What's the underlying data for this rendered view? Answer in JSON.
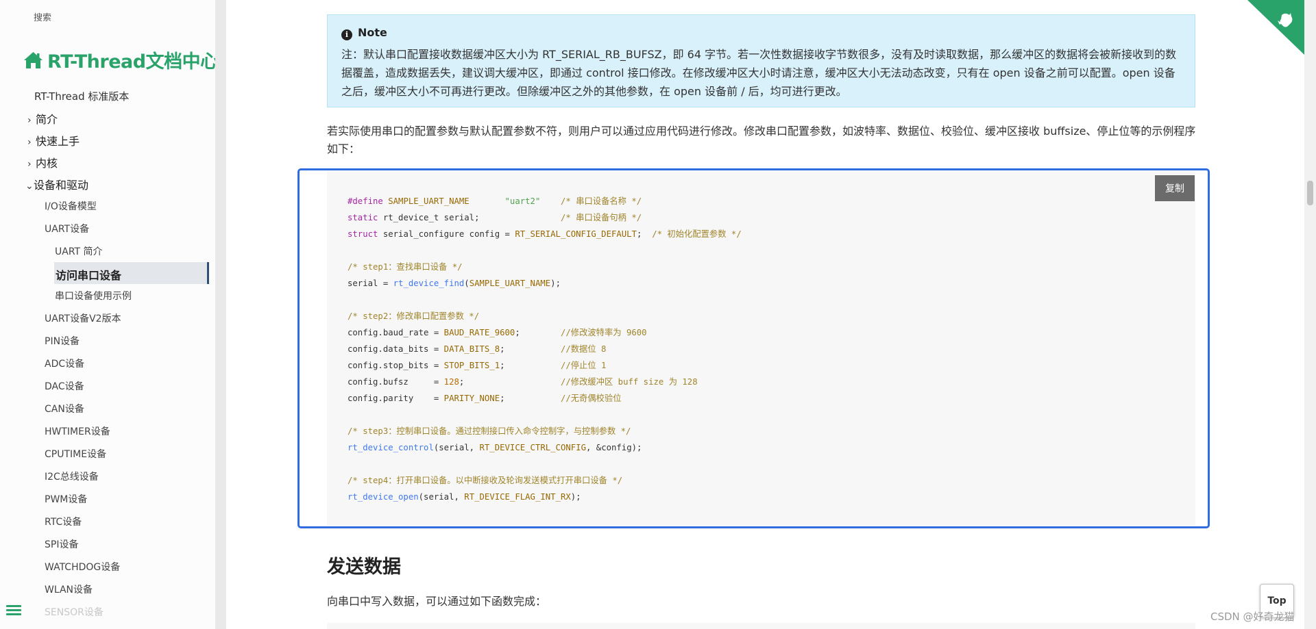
{
  "sidebar": {
    "search_placeholder": "搜索",
    "site_title": "RT-Thread文档中心",
    "version": "RT-Thread 标准版本",
    "top_items": [
      {
        "chevron": "›",
        "label": "简介"
      },
      {
        "chevron": "›",
        "label": "快速上手"
      },
      {
        "chevron": "›",
        "label": "内核"
      },
      {
        "chevron": "⌄",
        "label": "设备和驱动"
      }
    ],
    "level1_items": [
      "I/O设备模型",
      "UART设备"
    ],
    "level2_items": [
      "UART 简介",
      "访问串口设备",
      "串口设备使用示例"
    ],
    "active_item": "访问串口设备",
    "level1_after": [
      "UART设备V2版本",
      "PIN设备",
      "ADC设备",
      "DAC设备",
      "CAN设备",
      "HWTIMER设备",
      "CPUTIME设备",
      "I2C总线设备",
      "PWM设备",
      "RTC设备",
      "SPI设备",
      "WATCHDOG设备",
      "WLAN设备",
      "SENSOR设备"
    ]
  },
  "note": {
    "heading": "Note",
    "body": "注：默认串口配置接收数据缓冲区大小为 RT_SERIAL_RB_BUFSZ，即 64 字节。若一次性数据接收字节数很多，没有及时读取数据，那么缓冲区的数据将会被新接收到的数据覆盖，造成数据丢失，建议调大缓冲区，即通过 control 接口修改。在修改缓冲区大小时请注意，缓冲区大小无法动态改变，只有在 open 设备之前可以配置。open 设备之后，缓冲区大小不可再进行更改。但除缓冲区之外的其他参数，在 open 设备前 / 后，均可进行更改。"
  },
  "paragraph": "若实际使用串口的配置参数与默认配置参数不符，则用户可以通过应用代码进行修改。修改串口配置参数，如波特率、数据位、校验位、缓冲区接收 buffsize、停止位等的示例程序如下：",
  "code": {
    "copy_label": "复制",
    "lines": [
      "#define SAMPLE_UART_NAME       \"uart2\"    /* 串口设备名称 */",
      "static rt_device_t serial;                /* 串口设备句柄 */",
      "struct serial_configure config = RT_SERIAL_CONFIG_DEFAULT;  /* 初始化配置参数 */",
      "",
      "/* step1：查找串口设备 */",
      "serial = rt_device_find(SAMPLE_UART_NAME);",
      "",
      "/* step2：修改串口配置参数 */",
      "config.baud_rate = BAUD_RATE_9600;        //修改波特率为 9600",
      "config.data_bits = DATA_BITS_8;           //数据位 8",
      "config.stop_bits = STOP_BITS_1;           //停止位 1",
      "config.bufsz     = 128;                   //修改缓冲区 buff size 为 128",
      "config.parity    = PARITY_NONE;           //无奇偶校验位",
      "",
      "/* step3：控制串口设备。通过控制接口传入命令控制字，与控制参数 */",
      "rt_device_control(serial, RT_DEVICE_CTRL_CONFIG, &config);",
      "",
      "/* step4：打开串口设备。以中断接收及轮询发送模式打开串口设备 */",
      "rt_device_open(serial, RT_DEVICE_FLAG_INT_RX);"
    ]
  },
  "section": {
    "heading": "发送数据",
    "text": "向串口中写入数据，可以通过如下函数完成："
  },
  "top_button": "Top",
  "watermark": "CSDN @好奇龙猫",
  "colors": {
    "brand_green": "#2aa36b",
    "note_bg": "#d9f1fb",
    "highlight_border": "#2f6ce0",
    "code_bg": "#f7f7f7"
  },
  "icons": [
    "home-icon",
    "info-icon",
    "hamburger-icon",
    "github-corner-icon"
  ]
}
